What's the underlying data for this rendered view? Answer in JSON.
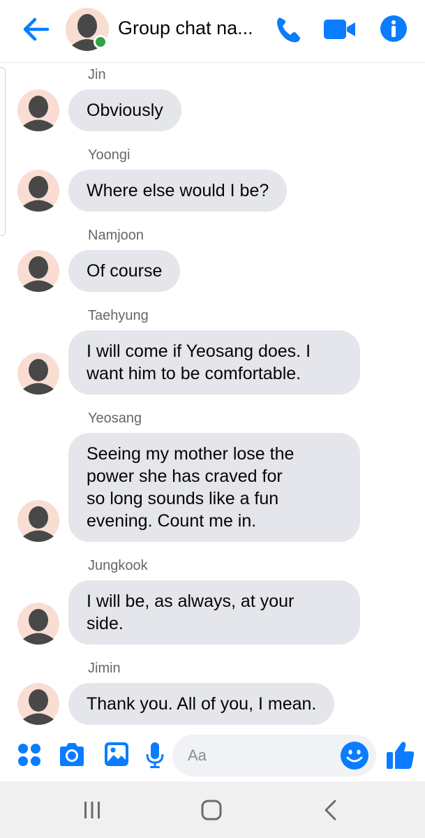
{
  "header": {
    "title": "Group chat na...",
    "back_icon": "arrow-left-icon",
    "call_icon": "phone-icon",
    "video_icon": "video-camera-icon",
    "info_icon": "info-icon",
    "online_status": "active"
  },
  "messages": [
    {
      "sender": "Jin",
      "text": "Obviously"
    },
    {
      "sender": "Yoongi",
      "text": "Where else would I be?"
    },
    {
      "sender": "Namjoon",
      "text": "Of course"
    },
    {
      "sender": "Taehyung",
      "lines": [
        "I will come if Yeosang does. I",
        "want him to be comfortable."
      ]
    },
    {
      "sender": "Yeosang",
      "lines": [
        "Seeing my mother lose the",
        "power she has craved for",
        "so long sounds like a fun",
        "evening. Count me in."
      ]
    },
    {
      "sender": "Jungkook",
      "lines": [
        "I will be, as always, at your",
        "side."
      ]
    },
    {
      "sender": "Jimin",
      "text": "Thank you. All of you, I mean."
    }
  ],
  "composer": {
    "placeholder": "Aa",
    "value": "",
    "icons": [
      "apps-grid-icon",
      "camera-icon",
      "gallery-icon",
      "microphone-icon",
      "emoji-icon",
      "thumbs-up-icon"
    ]
  },
  "navbar": {
    "icons": [
      "recents-icon",
      "home-icon",
      "back-icon"
    ]
  },
  "colors": {
    "accent": "#0a7cff",
    "bubble": "#e4e6eb",
    "sender_text": "#65676b",
    "online": "#31a24c",
    "avatar_bg": "#f9ddd2",
    "avatar_fg": "#484848"
  }
}
